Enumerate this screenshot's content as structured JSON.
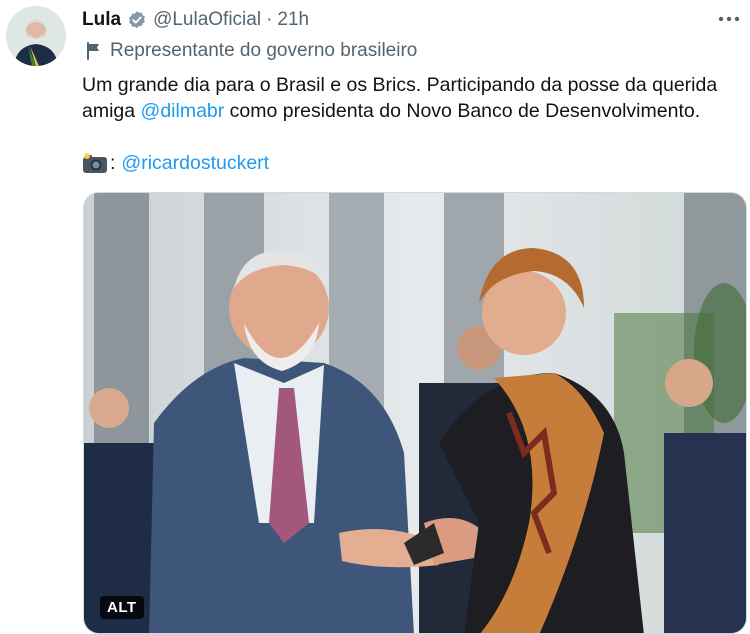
{
  "author": {
    "name": "Lula",
    "handle": "@LulaOficial",
    "separator": "·",
    "time": "21h"
  },
  "label": {
    "text": "Representante do governo brasileiro"
  },
  "tweet": {
    "line1": "Um grande dia para o Brasil e os Brics. Participando da posse da querida",
    "line2_pre": "amiga ",
    "mention": "@dilmabr",
    "line2_post": " como presidenta do Novo Banco de Desenvolvimento.",
    "credit_sep": ":",
    "credit_handle": "@ricardostuckert"
  },
  "media": {
    "alt_badge": "ALT"
  },
  "icons": {
    "verified": "verified-badge-icon",
    "flag": "flag-icon",
    "camera": "camera-flash-icon",
    "more": "more-options-icon"
  },
  "colors": {
    "link": "#1d9bf0",
    "secondary_text": "#536471",
    "verified_badge": "#829aab"
  }
}
